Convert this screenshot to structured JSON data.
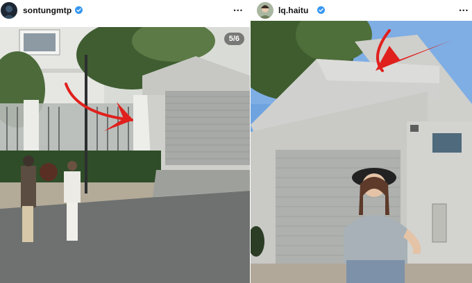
{
  "left_post": {
    "username": "sontungmtp",
    "verified_icon": "verified-badge-icon",
    "more_label": "...",
    "carousel_counter": "5/6",
    "annotation": "red-arrow-icon"
  },
  "right_post": {
    "username": "lq.haitu",
    "verified_icon": "verified-badge-icon",
    "more_label": "...",
    "annotation": "red-arrow-icon"
  },
  "colors": {
    "verified": "#3797f0",
    "arrow": "#e0201d",
    "garage_wall": "#c9c9c6",
    "sky": "#6fa3df"
  }
}
